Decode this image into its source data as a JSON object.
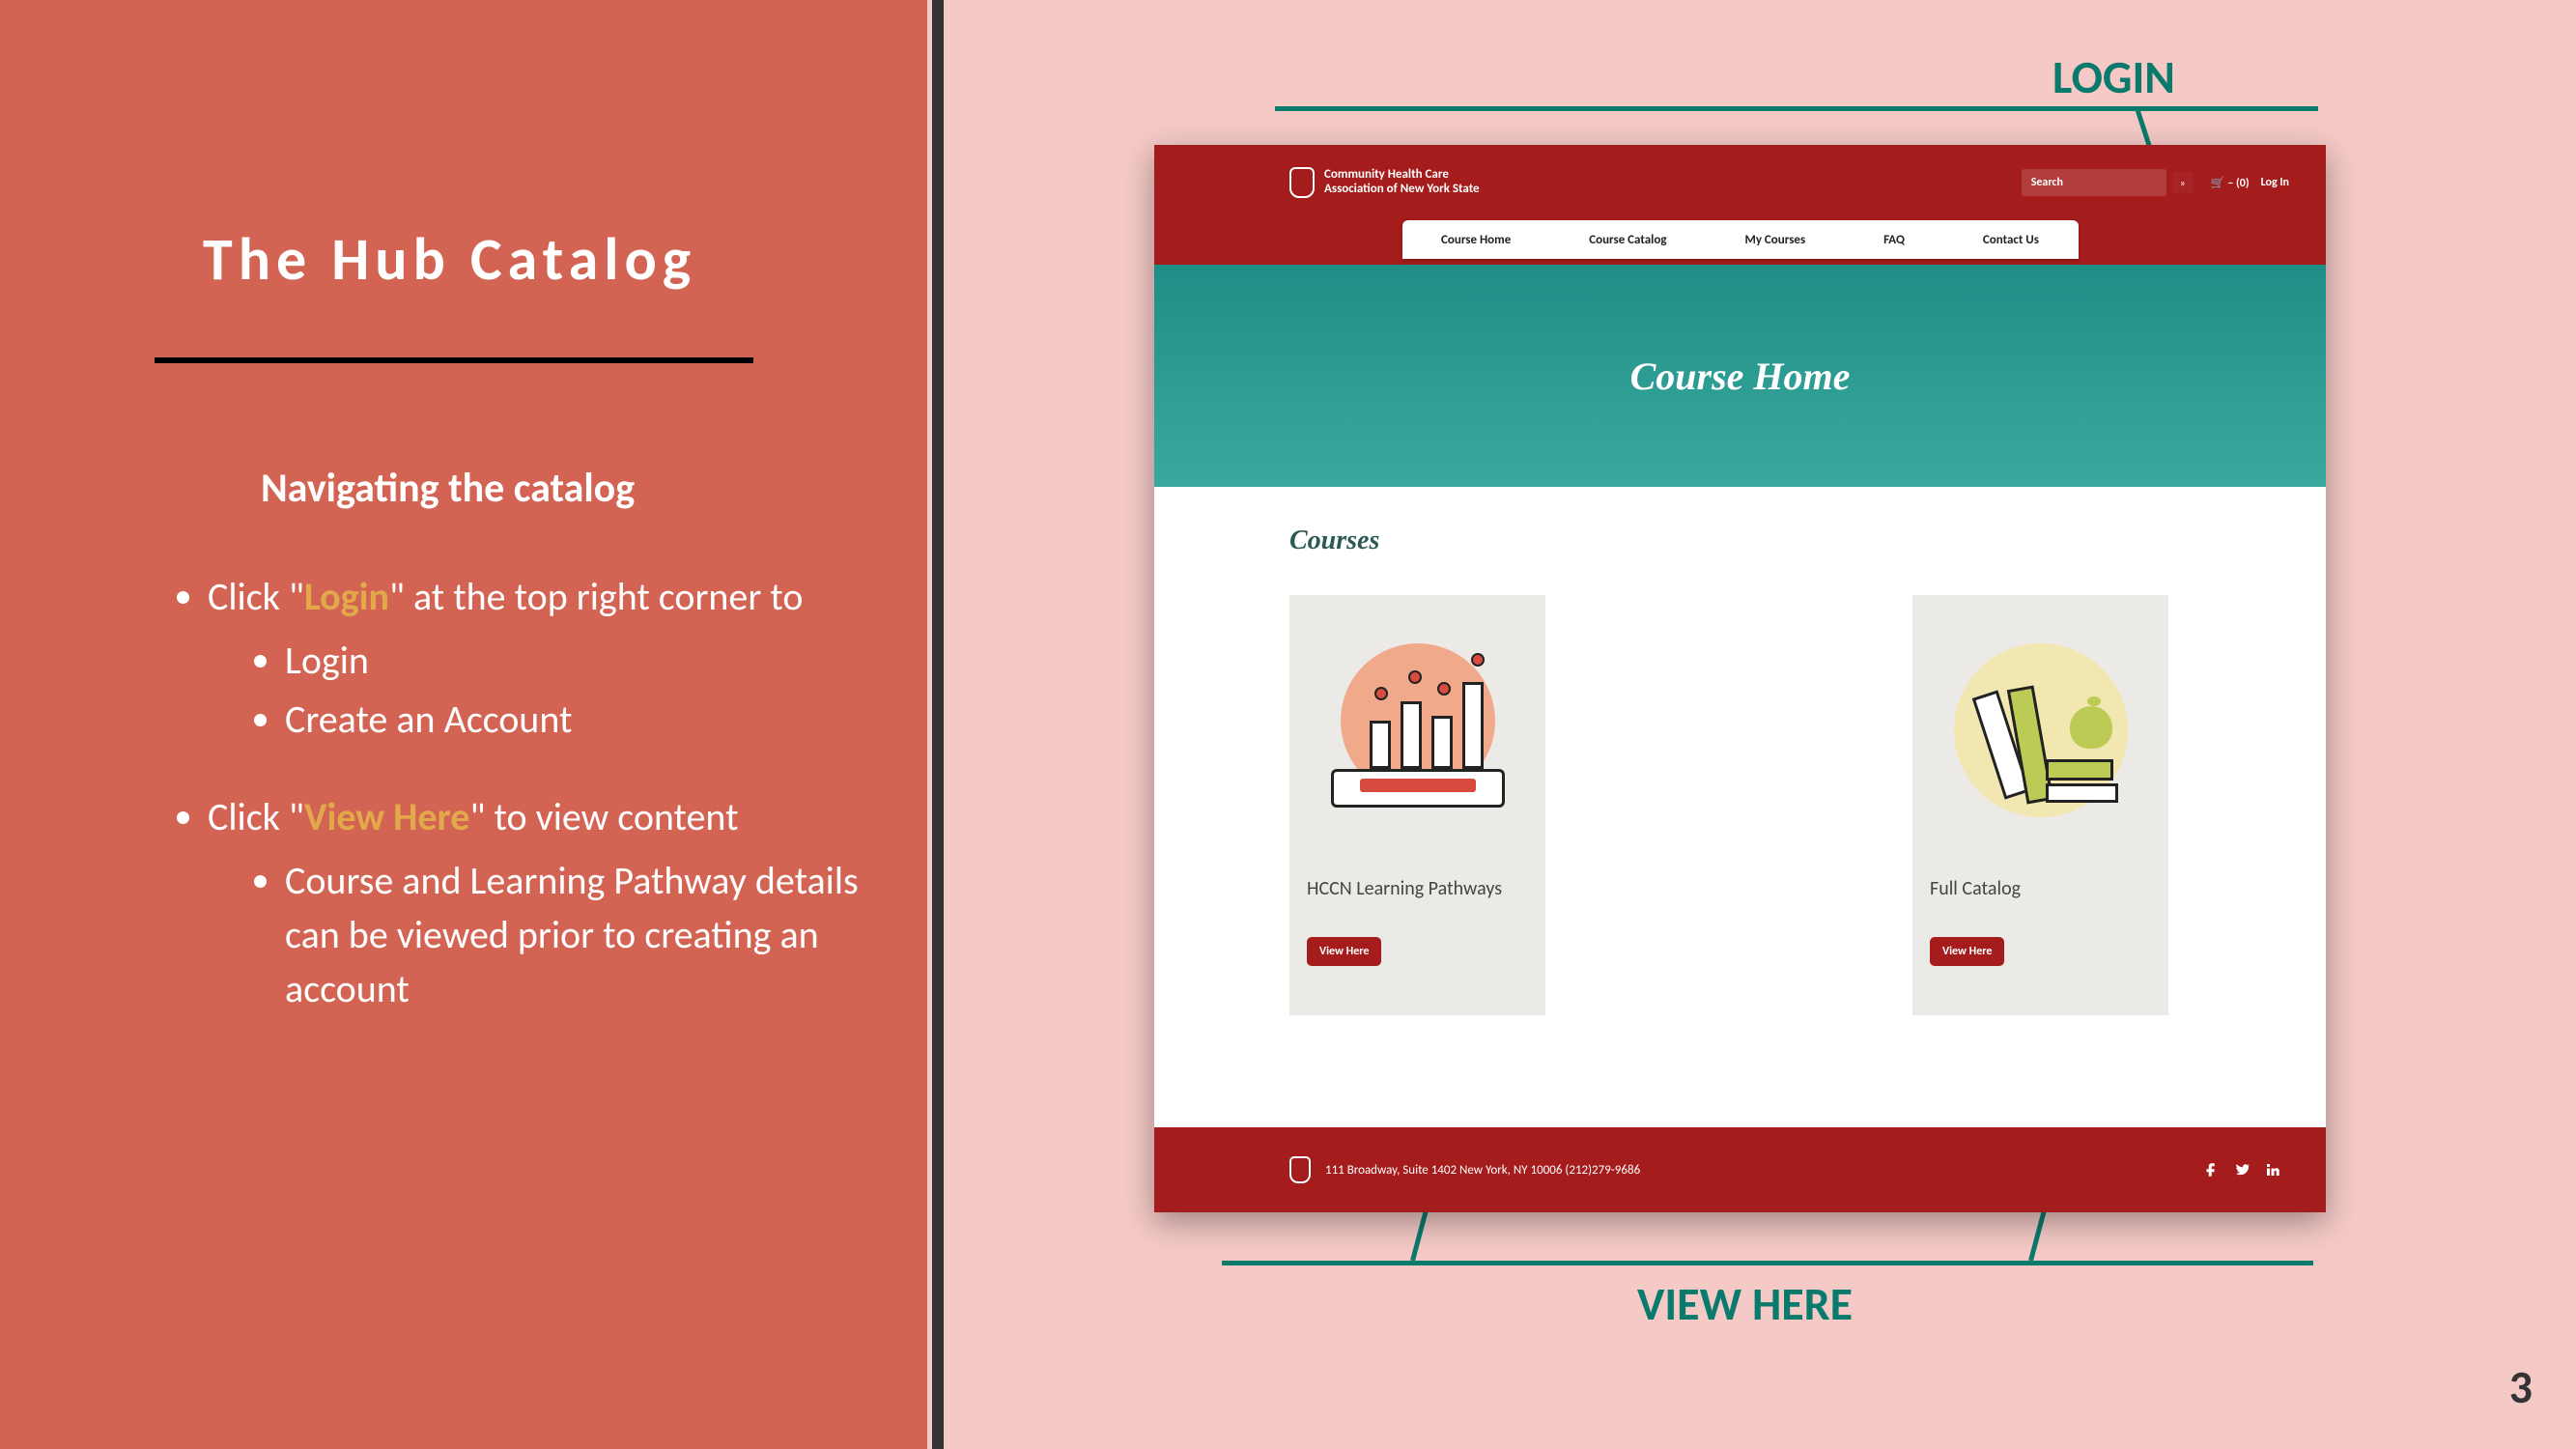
{
  "colors": {
    "accent": "#e2a94a",
    "teal": "#0a7a6d",
    "left_bg": "#d36454",
    "right_bg": "#f4c9c6",
    "brand_red": "#a51c1c"
  },
  "slide": {
    "title": "The Hub Catalog",
    "subtitle": "Navigating the catalog",
    "page_number": "3",
    "bullets": [
      {
        "pre": "Click \"",
        "accent": "Login",
        "post": "\" at the top right corner to",
        "subs": [
          "Login",
          "Create an Account"
        ]
      },
      {
        "pre": "Click \"",
        "accent": "View Here",
        "post": "\" to view content",
        "subs": [
          "Course and Learning Pathway details can be viewed prior to creating an account"
        ]
      }
    ]
  },
  "callouts": {
    "login": "LOGIN",
    "view_here": "VIEW HERE"
  },
  "shot": {
    "brand_line1": "Community Health Care",
    "brand_line2": "Association of New York State",
    "search_placeholder": "Search",
    "cart_text": "🛒 – (0)",
    "login_text": "Log In",
    "nav": [
      "Course Home",
      "Course Catalog",
      "My Courses",
      "FAQ",
      "Contact Us"
    ],
    "hero": "Course Home",
    "courses_heading": "Courses",
    "cards": [
      {
        "title": "HCCN Learning Pathways",
        "button": "View Here"
      },
      {
        "title": "Full Catalog",
        "button": "View Here"
      }
    ],
    "footer_addr": "111 Broadway, Suite 1402   New York, NY 10006   (212)279-9686",
    "social": [
      "facebook-icon",
      "twitter-icon",
      "linkedin-icon"
    ]
  }
}
